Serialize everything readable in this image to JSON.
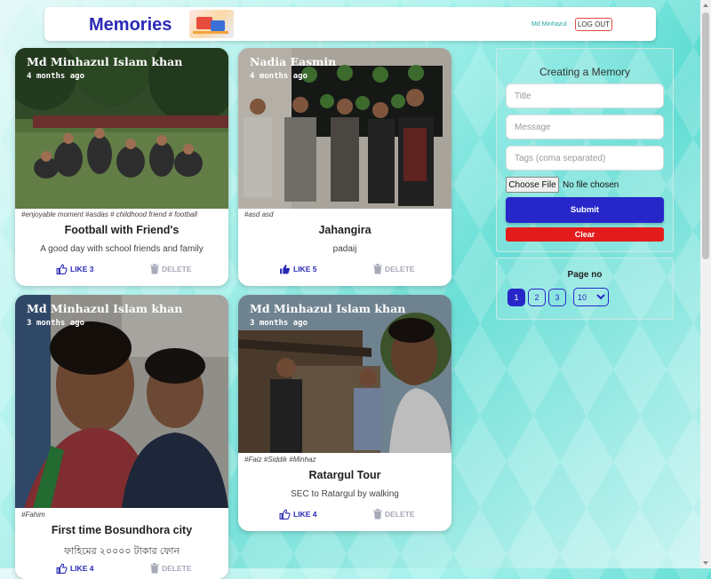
{
  "header": {
    "brand": "Memories",
    "username": "Md Minhazul",
    "logout_label": "LOG OUT"
  },
  "posts": [
    {
      "author": "Md Minhazul Islam khan",
      "time": "4 months ago",
      "tags": "#enjoyable moment #asdas # childhood friend # football",
      "title": "Football with Friend's",
      "message": "A good day with school friends and family",
      "like_label": "LIKE 3",
      "like_filled": false,
      "delete_label": "DELETE"
    },
    {
      "author": "Nadia Easmin",
      "time": "4 months ago",
      "tags": "#asd asd",
      "title": "Jahangira",
      "message": "padaij",
      "like_label": "LIKE 5",
      "like_filled": true,
      "delete_label": "DELETE"
    },
    {
      "author": "Md Minhazul Islam khan",
      "time": "3 months ago",
      "tags": "#Fahim",
      "title": "First time Bosundhora city",
      "message": "ফাহিমের ২০০০০ টাকার ফোন",
      "like_label": "LIKE 4",
      "like_filled": false,
      "delete_label": "DELETE"
    },
    {
      "author": "Md Minhazul Islam khan",
      "time": "3 months ago",
      "tags": "#Faiz #Siddik #Minhaz",
      "title": "Ratargul Tour",
      "message": "SEC to Ratargul by walking",
      "like_label": "LIKE 4",
      "like_filled": false,
      "delete_label": "DELETE"
    }
  ],
  "form": {
    "title": "Creating a Memory",
    "title_placeholder": "Title",
    "message_placeholder": "Message",
    "tags_placeholder": "Tags (coma separated)",
    "file_button": "Choose File",
    "file_status": "No file chosen",
    "submit_label": "Submit",
    "clear_label": "Clear"
  },
  "pagination": {
    "label": "Page no",
    "pages": [
      "1",
      "2",
      "3"
    ],
    "current_page": "1",
    "per_page": "10"
  },
  "colors": {
    "primary": "#2727c9",
    "danger": "#e41b1b",
    "accent_teal": "#26a6a0"
  }
}
